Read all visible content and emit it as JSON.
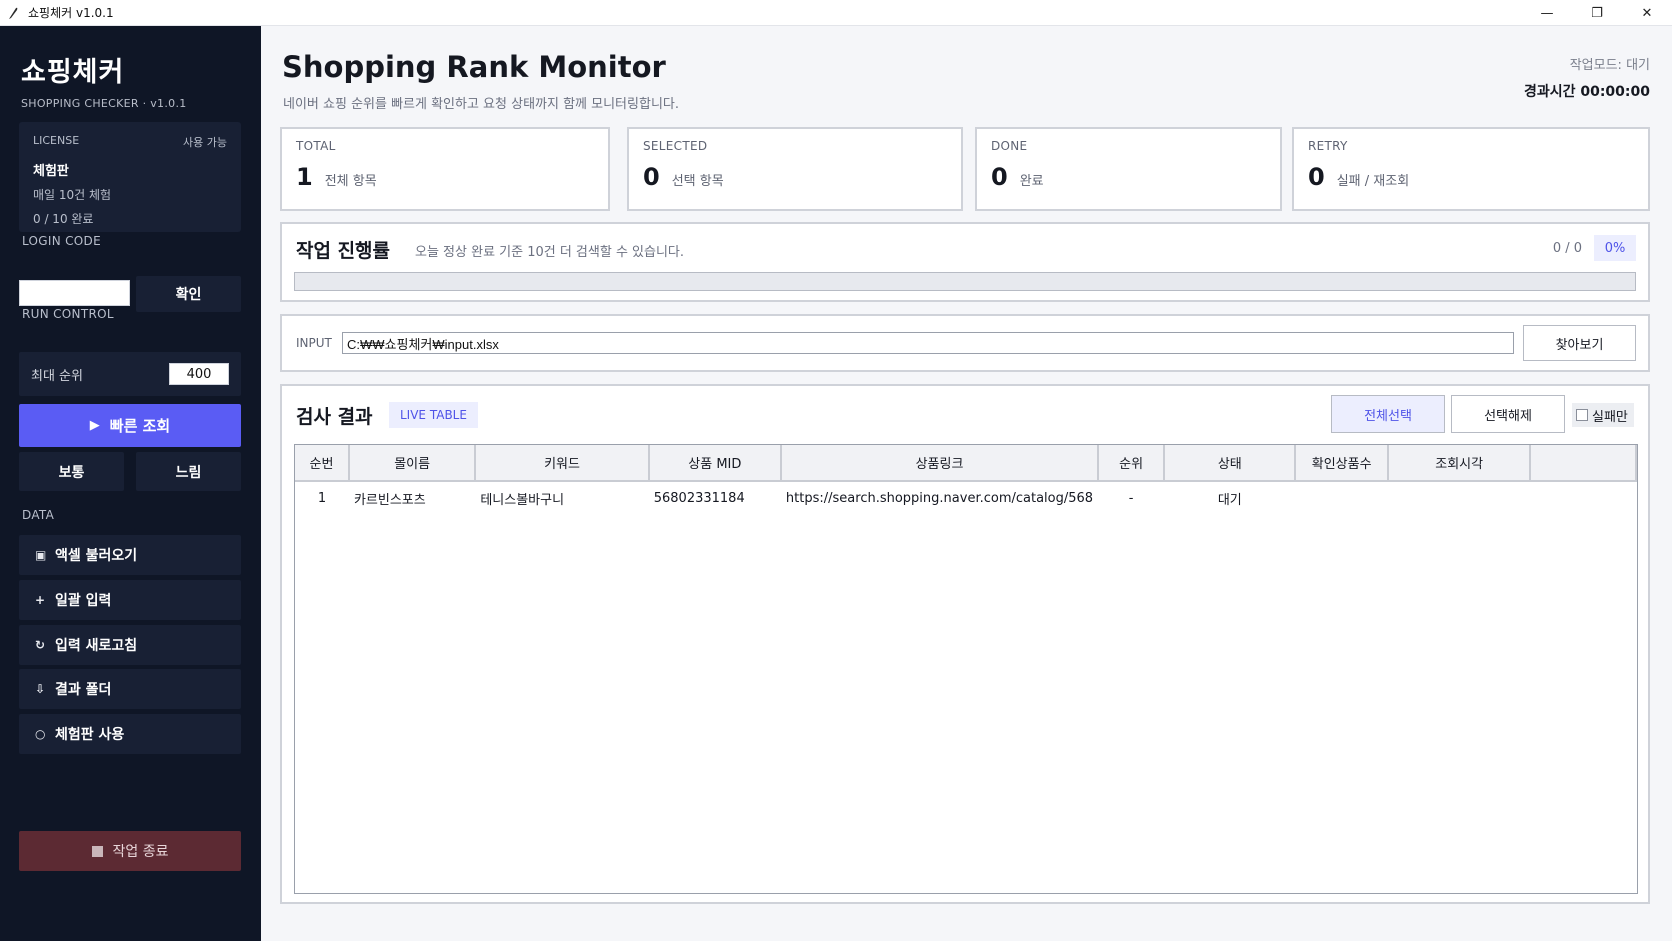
{
  "window": {
    "title": "쇼핑체커 v1.0.1",
    "minimize": "—",
    "restore": "❐",
    "close": "✕"
  },
  "sidebar": {
    "brand_title": "쇼핑체커",
    "brand_subtitle": "SHOPPING CHECKER  ·  v1.0.1",
    "license": {
      "label": "LICENSE",
      "status": "사용 가능",
      "plan": "체험판",
      "daily": "매일 10건 체험",
      "usage": "0 / 10 완료"
    },
    "login_code_label": "LOGIN CODE",
    "login_code_value": "",
    "confirm_label": "확인",
    "run_control_label": "RUN CONTROL",
    "max_rank_label": "최대 순위",
    "max_rank_value": "400",
    "fast_label": "빠른 조회",
    "normal_label": "보통",
    "slow_label": "느림",
    "data_label": "DATA",
    "data_items": [
      {
        "icon": "▣",
        "label": "액셀 불러오기"
      },
      {
        "icon": "+",
        "label": "일괄 입력"
      },
      {
        "icon": "↻",
        "label": "입력 새로고침"
      },
      {
        "icon": "⇩",
        "label": "결과 폴더"
      },
      {
        "icon": "○",
        "label": "체험판 사용"
      }
    ],
    "end_label": "작업 종료"
  },
  "header": {
    "title": "Shopping Rank Monitor",
    "subtitle": "네이버 쇼핑 순위를 빠르게 확인하고 요청 상태까지 함께 모니터링합니다.",
    "mode": "작업모드: 대기",
    "elapsed": "경과시간  00:00:00"
  },
  "stats": [
    {
      "label": "TOTAL",
      "value": "1",
      "desc": "전체 항목"
    },
    {
      "label": "SELECTED",
      "value": "0",
      "desc": "선택 항목"
    },
    {
      "label": "DONE",
      "value": "0",
      "desc": "완료"
    },
    {
      "label": "RETRY",
      "value": "0",
      "desc": "실패 / 재조회"
    }
  ],
  "progress": {
    "title": "작업 진행률",
    "note": "오늘 정상 완료 기준 10건 더 검색할 수 있습니다.",
    "count": "0 / 0",
    "percent": "0%",
    "fraction": 0
  },
  "input": {
    "label": "INPUT",
    "path": "C:₩₩쇼핑체커₩input.xlsx",
    "browse_label": "찾아보기"
  },
  "results": {
    "title": "검사 결과",
    "badge": "LIVE TABLE",
    "select_all": "전체선택",
    "deselect": "선택해제",
    "fail_only": "실패만",
    "columns": [
      "순번",
      "몰이름",
      "키워드",
      "상품 MID",
      "상품링크",
      "순위",
      "상태",
      "확인상품수",
      "조회시각",
      ""
    ],
    "rows": [
      [
        "1",
        "카르빈스포츠",
        "테니스볼바구니",
        "56802331184",
        "https://search.shopping.naver.com/catalog/568",
        "-",
        "대기",
        "",
        "",
        ""
      ]
    ]
  },
  "colors": {
    "sidebar_bg": "#0f1626",
    "accent": "#5a5cf4",
    "danger": "#5c2a33"
  }
}
